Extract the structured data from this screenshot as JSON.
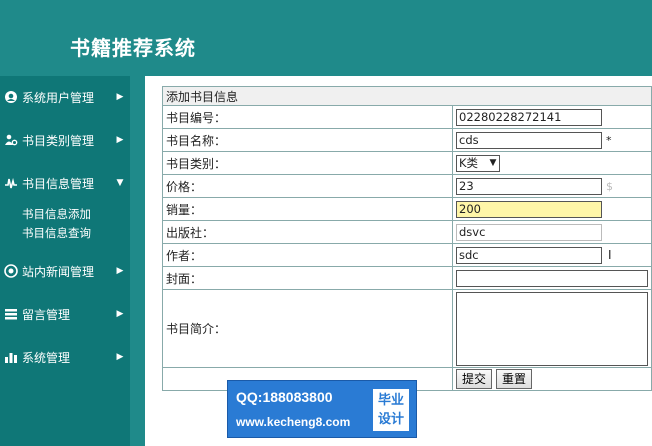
{
  "app": {
    "title": "书籍推荐系统"
  },
  "sidebar": {
    "items": [
      {
        "label": "系统用户管理",
        "icon": "user-circle-icon",
        "expanded": false
      },
      {
        "label": "书目类别管理",
        "icon": "people-icon",
        "expanded": false
      },
      {
        "label": "书目信息管理",
        "icon": "signal-icon",
        "expanded": true
      },
      {
        "label": "站内新闻管理",
        "icon": "target-icon",
        "expanded": false
      },
      {
        "label": "留言管理",
        "icon": "stack-icon",
        "expanded": false
      },
      {
        "label": "系统管理",
        "icon": "bar-chart-icon",
        "expanded": false
      }
    ],
    "subitems": [
      {
        "label": "书目信息添加"
      },
      {
        "label": "书目信息查询"
      }
    ]
  },
  "form": {
    "caption": "添加书目信息",
    "rows": [
      {
        "label": "书目编号：",
        "value": "02280228272141"
      },
      {
        "label": "书目名称：",
        "value": "cds",
        "required": "*"
      },
      {
        "label": "书目类别：",
        "value": "K类"
      },
      {
        "label": "价格：",
        "value": "23",
        "suffix": "$"
      },
      {
        "label": "销量：",
        "value": "200"
      },
      {
        "label": "出版社：",
        "value": "dsvc"
      },
      {
        "label": "作者：",
        "value": "sdc"
      },
      {
        "label": "封面：",
        "value": ""
      },
      {
        "label": "书目简介：",
        "value": ""
      }
    ],
    "submit_label": "提交",
    "reset_label": "重置"
  },
  "watermark": {
    "qq": "QQ:188083800",
    "site": "www.kecheng8.com",
    "badge_line1": "毕业",
    "badge_line2": "设计"
  },
  "colors": {
    "header": "#1f8a8a",
    "sidebar": "#0f7777",
    "highlight_field": "#fff6a8",
    "watermark": "#2a7bd4"
  }
}
